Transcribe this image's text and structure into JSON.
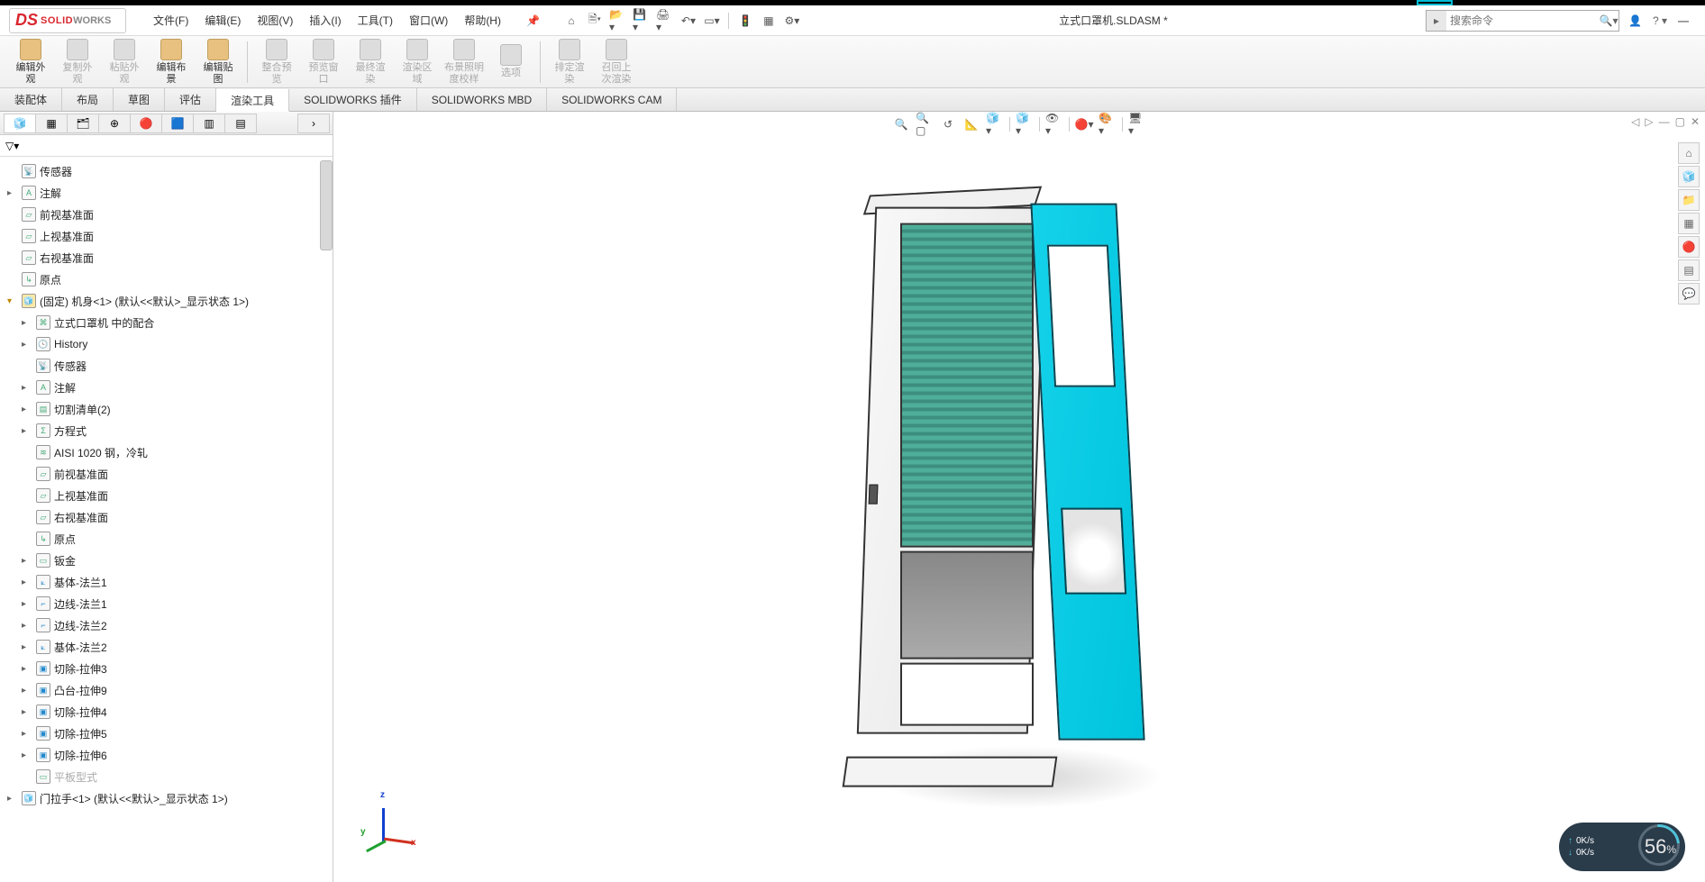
{
  "app": {
    "name_solid": "SOLID",
    "name_works": "WORKS",
    "ds": "DS"
  },
  "menu": {
    "file": "文件(F)",
    "edit": "编辑(E)",
    "view": "视图(V)",
    "insert": "插入(I)",
    "tools": "工具(T)",
    "window": "窗口(W)",
    "help": "帮助(H)"
  },
  "doc_title": "立式口罩机.SLDASM *",
  "search": {
    "placeholder": "搜索命令"
  },
  "ribbon": {
    "edit_appearance": "编辑外\n观",
    "copy_appearance": "复制外\n观",
    "paste_appearance": "粘贴外\n观",
    "edit_scene": "编辑布\n景",
    "edit_decal": "编辑贴\n图",
    "integrate_preview": "整合预\n览",
    "preview_window": "预览窗\n口",
    "final_render": "最终渲\n染",
    "render_region": "渲染区\n域",
    "scene_lighting": "布景照明\n度校样",
    "options": "选项",
    "schedule_render": "排定渲\n染",
    "recall_last_render": "召回上\n次渲染"
  },
  "tabs": {
    "assembly": "装配体",
    "layout": "布局",
    "sketch": "草图",
    "evaluate": "评估",
    "render_tools": "渲染工具",
    "sw_addins": "SOLIDWORKS 插件",
    "sw_mbd": "SOLIDWORKS MBD",
    "sw_cam": "SOLIDWORKS CAM"
  },
  "tree": {
    "sensors": "传感器",
    "annotations": "注解",
    "front_plane": "前视基准面",
    "top_plane": "上视基准面",
    "right_plane": "右视基准面",
    "origin": "原点",
    "fixed_body": "(固定) 机身<1> (默认<<默认>_显示状态 1>)",
    "mates_in": "立式口罩机 中的配合",
    "history": "History",
    "sensors2": "传感器",
    "annotations2": "注解",
    "cutlist": "切割清单(2)",
    "equations": "方程式",
    "material": "AISI 1020 钢，冷轧",
    "front_plane2": "前视基准面",
    "top_plane2": "上视基准面",
    "right_plane2": "右视基准面",
    "origin2": "原点",
    "sheetmetal": "钣金",
    "baseflange1": "基体-法兰1",
    "edgeflange1": "边线-法兰1",
    "edgeflange2": "边线-法兰2",
    "baseflange2": "基体-法兰2",
    "cutextrude3": "切除-拉伸3",
    "bossextrude9": "凸台-拉伸9",
    "cutextrude4": "切除-拉伸4",
    "cutextrude5": "切除-拉伸5",
    "cutextrude6": "切除-拉伸6",
    "flatpattern": "平板型式",
    "handle_part": "门拉手<1> (默认<<默认>_显示状态 1>)"
  },
  "triad": {
    "x": "x",
    "y": "y",
    "z": "z"
  },
  "net": {
    "up": "0K/s",
    "down": "0K/s",
    "pct": "56",
    "pct_unit": "%"
  }
}
